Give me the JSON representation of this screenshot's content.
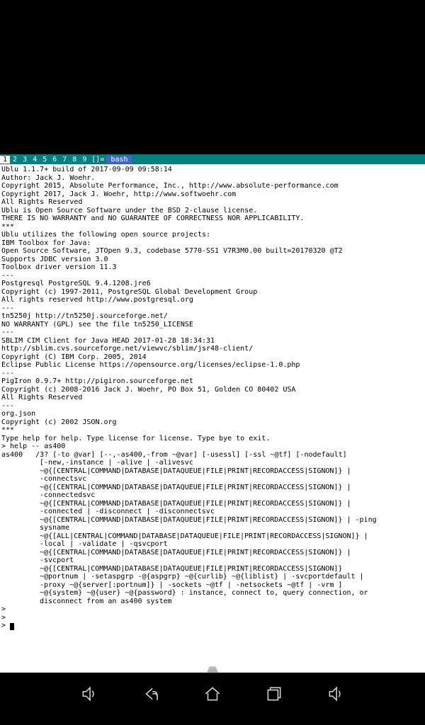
{
  "tabs": {
    "numbers": [
      "1",
      "2",
      "3",
      "4",
      "5",
      "6",
      "7",
      "8",
      "9"
    ],
    "bracket": "[]=",
    "label": "bash"
  },
  "terminal": {
    "line1": "Ublu 1.1.7+ build of 2017-09-09 09:58:14",
    "line2": "Author: Jack J. Woehr.",
    "line3": "Copyright 2015, Absolute Performance, Inc., http://www.absolute-performance.com",
    "line4": "Copyright 2017, Jack J. Woehr, http://www.softwoehr.com",
    "line5": "All Rights Reserved",
    "line6": "Ublu is Open Source Software under the BSD 2-clause license.",
    "line7": "THERE IS NO WARRANTY and NO GUARANTEE OF CORRECTNESS NOR APPLICABILITY.",
    "sep1": "***",
    "line8": "Ublu utilizes the following open source projects:",
    "line9": "IBM Toolbox for Java:",
    "line10": "Open Source Software, JTOpen 9.3, codebase 5770-SS1 V7R3M0.00 built=20170320 @T2",
    "line11": "Supports JDBC version 3.0",
    "line12": "Toolbox driver version 11.3",
    "dash1": "---",
    "line13": "Postgresql PostgreSQL 9.4.1208.jre6",
    "line14": "Copyright (c) 1997-2011, PostgreSQL Global Development Group",
    "line15": "All rights reserved http://www.postgresql.org",
    "dash2": "---",
    "line16": "tn5250j http://tn5250j.sourceforge.net/",
    "line17": "NO WARRANTY (GPL) see the file tn5250_LICENSE",
    "dash3": "---",
    "line18": "SBLIM CIM Client for Java HEAD 2017-01-28 18:34:31",
    "line19": "http://sblim.cvs.sourceforge.net/viewvc/sblim/jsr48-client/",
    "line20": "Copyright (C) IBM Corp. 2005, 2014",
    "line21": "Eclipse Public License https://opensource.org/licenses/eclipse-1.0.php",
    "dash4": "---",
    "line22": "PigIron 0.9.7+ http://pigiron.sourceforge.net",
    "line23": "Copyright (c) 2008-2016 Jack J. Woehr, PO Box 51, Golden CO 80402 USA",
    "line24": "All Rights Reserved",
    "dash5": "---",
    "line25": "org.json",
    "line26": "Copyright (c) 2002 JSON.org",
    "sep2": "***",
    "line27": "Type help for help. Type license for license. Type bye to exit.",
    "prompt1": "> help -- as400",
    "help1": "as400   /3? [-to @var] [--,-as400,-from ~@var] [-usessl] [-ssl ~@tf] [-nodefault]",
    "help2": "[-new,-instance | -alive | -alivesvc",
    "help3": "~@{[CENTRAL|COMMAND|DATABASE|DATAQUEUE|FILE|PRINT|RECORDACCESS|SIGNON]} |",
    "help4": "-connectsvc",
    "help5": "~@{[CENTRAL|COMMAND|DATABASE|DATAQUEUE|FILE|PRINT|RECORDACCESS|SIGNON]} |",
    "help6": "-connectedsvc",
    "help7": "~@{[CENTRAL|COMMAND|DATABASE|DATAQUEUE|FILE|PRINT|RECORDACCESS|SIGNON]} |",
    "help8": "-connected | -disconnect | -disconnectsvc",
    "help9": "~@{[CENTRAL|COMMAND|DATABASE|DATAQUEUE|FILE|PRINT|RECORDACCESS|SIGNON]} | -ping",
    "help10": "sysname",
    "help11": "~@{[ALL|CENTRAL|COMMAND|DATABASE|DATAQUEUE|FILE|PRINT|RECORDACCESS|SIGNON]} |",
    "help12": "-local | -validate | -qsvcport",
    "help13": "~@{[CENTRAL|COMMAND|DATABASE|DATAQUEUE|FILE|PRINT|RECORDACCESS|SIGNON]} |",
    "help14": "-svcport",
    "help15": "~@{[CENTRAL|COMMAND|DATABASE|DATAQUEUE|FILE|PRINT|RECORDACCESS|SIGNON]}",
    "help16": "~@portnum | -setaspgrp -@{aspgrp} ~@{curlib} ~@{liblist} | -svcportdefault |",
    "help17": "-proxy ~@{server[:portnum]} | -sockets ~@tf | -netsockets ~@tf | -vrm ]",
    "help18": "~@{system} ~@{user} ~@{password} : instance, connect to, query connection, or",
    "help19": "disconnect from an as400 system",
    "prompt2": ">",
    "prompt3": ">",
    "prompt4": "> "
  }
}
